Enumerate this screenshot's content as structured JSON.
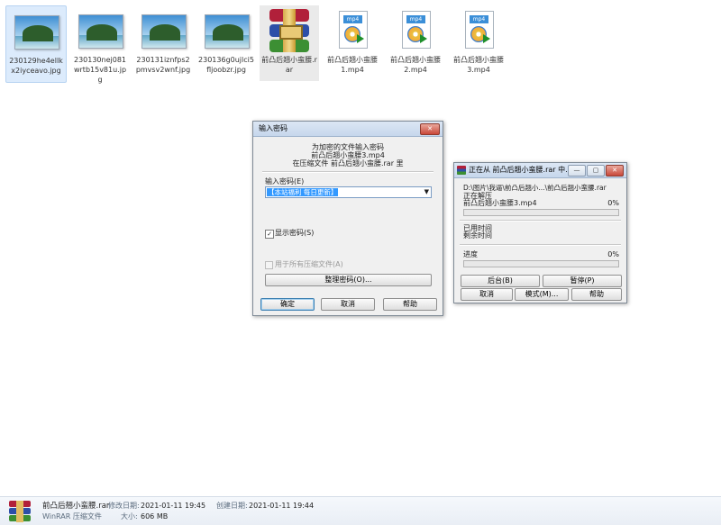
{
  "files": [
    {
      "name": "230129he4ellkx2iyceavo.jpg",
      "type": "image"
    },
    {
      "name": "230130nej081wrtb15v81u.jpg",
      "type": "image"
    },
    {
      "name": "230131iznfps2pmvsv2wnf.jpg",
      "type": "image"
    },
    {
      "name": "230136g0ujlci5fljoobzr.jpg",
      "type": "image"
    },
    {
      "name": "前凸后翘小蛮腰.rar",
      "type": "rar"
    },
    {
      "name": "前凸后翘小蛮腰1.mp4",
      "type": "video",
      "badge": "mp4"
    },
    {
      "name": "前凸后翘小蛮腰2.mp4",
      "type": "video",
      "badge": "mp4"
    },
    {
      "name": "前凸后翘小蛮腰3.mp4",
      "type": "video",
      "badge": "mp4"
    }
  ],
  "password_dialog": {
    "title": "输入密码",
    "close": "✕",
    "msg1": "为加密的文件输入密码",
    "msg2": "前凸后翘小蛮腰3.mp4",
    "msg3": "在压缩文件 前凸后翘小蛮腰.rar 里",
    "password_label": "输入密码(E)",
    "password_value": "【本站福利 每日更新】",
    "show_password_label": "显示密码(S)",
    "show_password_checked": true,
    "all_archives_label": "用于所有压缩文件(A)",
    "organize_button": "整理密码(O)...",
    "ok": "确定",
    "cancel": "取消",
    "help": "帮助"
  },
  "extract_dialog": {
    "title": "正在从 前凸后翘小蛮腰.rar 中...",
    "min": "—",
    "max": "▢",
    "close": "✕",
    "path": "D:\\图片\\我逼\\前凸后翘小...\\前凸后翘小蛮腰.rar",
    "status": "正在解压",
    "file": "前凸后翘小蛮腰3.mp4",
    "file_percent": "0%",
    "elapsed_label": "已用时间",
    "remaining_label": "剩余时间",
    "progress_label": "进度",
    "progress_percent": "0%",
    "background_button": "后台(B)",
    "pause_button": "暂停(P)",
    "cancel_button": "取消",
    "mode_button": "模式(M)...",
    "help_button": "帮助"
  },
  "statusbar": {
    "name": "前凸后翘小蛮腰.rar",
    "type": "WinRAR 压缩文件",
    "modified_label": "修改日期:",
    "modified": "2021-01-11 19:45",
    "created_label": "创建日期:",
    "created": "2021-01-11 19:44",
    "size_label": "大小:",
    "size": "606 MB"
  }
}
